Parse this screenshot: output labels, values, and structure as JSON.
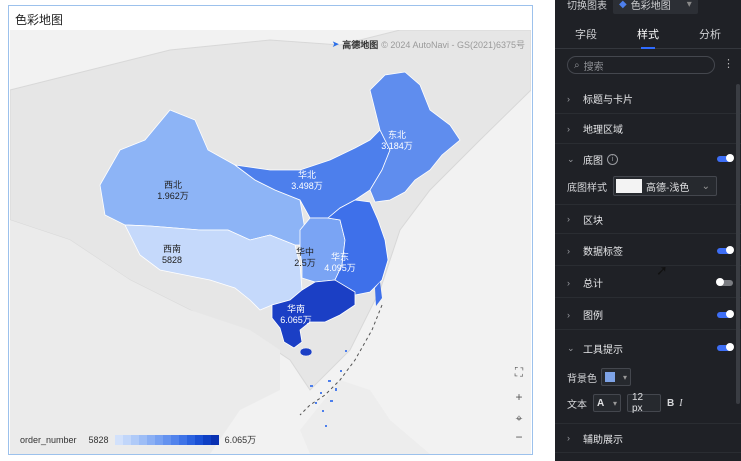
{
  "card": {
    "title": "色彩地图"
  },
  "attribution": {
    "brand": "高德地图",
    "text": "© 2024 AutoNavi - GS(2021)6375号"
  },
  "map": {
    "regions": [
      {
        "name": "西北",
        "value": 19620,
        "value_label": "1.962万",
        "color": "#8db4f6"
      },
      {
        "name": "华北",
        "value": 34980,
        "value_label": "3.498万",
        "color": "#4d7fec"
      },
      {
        "name": "东北",
        "value": 31840,
        "value_label": "3.184万",
        "color": "#5f8dee"
      },
      {
        "name": "西南",
        "value": 5828,
        "value_label": "5828",
        "color": "#c5d9fb"
      },
      {
        "name": "华中",
        "value": 25000,
        "value_label": "2.5万",
        "color": "#7aa4f4"
      },
      {
        "name": "华东",
        "value": 40950,
        "value_label": "4.095万",
        "color": "#3e70ea"
      },
      {
        "name": "华南",
        "value": 60650,
        "value_label": "6.065万",
        "color": "#1b3fc5"
      }
    ]
  },
  "legend": {
    "field": "order_number",
    "min_label": "5828",
    "max_label": "6.065万",
    "colors": [
      "#d2e1fb",
      "#c1d6fa",
      "#afcaf8",
      "#9dbdf6",
      "#8aaff4",
      "#77a1f2",
      "#6492ef",
      "#5183ec",
      "#3e73e7",
      "#2b62df",
      "#1a50d4",
      "#0e3fc4",
      "#0931b2"
    ]
  },
  "map_controls": [
    "fullscreen",
    "zoom-in",
    "locate",
    "zoom-out"
  ],
  "panel": {
    "topbar": {
      "label": "切换图表",
      "chart_type": "色彩地图"
    },
    "tabs": [
      {
        "label": "字段"
      },
      {
        "label": "样式"
      },
      {
        "label": "分析"
      }
    ],
    "search_placeholder": "搜索",
    "sections": {
      "title_card": "标题与卡片",
      "geo_area": "地理区域",
      "basemap": "底图",
      "basemap_style_label": "底图样式",
      "basemap_style_value": "高德-浅色",
      "block": "区块",
      "data_label": "数据标签",
      "total": "总计",
      "legend": "图例",
      "tooltip": "工具提示",
      "bg_color_label": "背景色",
      "bg_color_value": "#7ea3e6",
      "text_label": "文本",
      "font_size": "12 px",
      "bold": "B",
      "italic": "I",
      "aux": "辅助展示"
    },
    "toggles": {
      "basemap": true,
      "data_label": true,
      "total": false,
      "legend": true,
      "tooltip": true
    }
  }
}
